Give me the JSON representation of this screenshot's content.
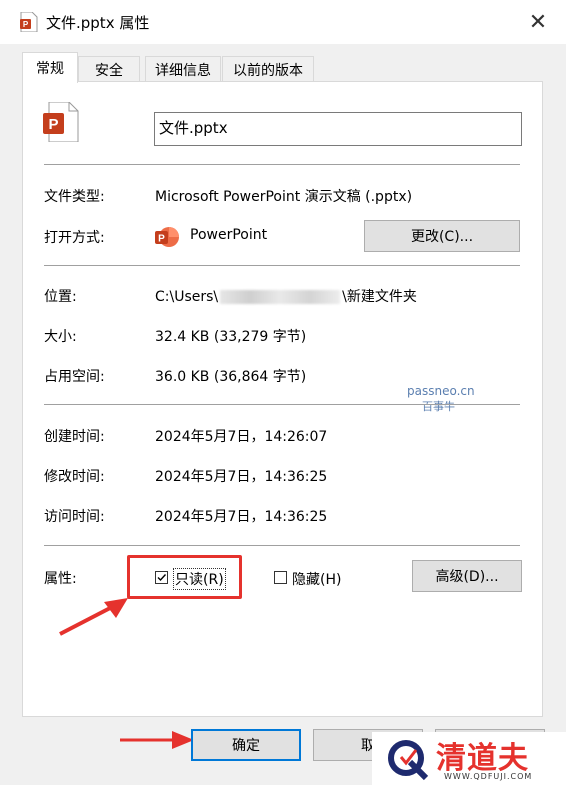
{
  "window": {
    "title": "文件.pptx 属性",
    "close_glyph": "✕"
  },
  "tabs": [
    {
      "label": "常规",
      "active": true
    },
    {
      "label": "安全",
      "active": false
    },
    {
      "label": "详细信息",
      "active": false
    },
    {
      "label": "以前的版本",
      "active": false
    }
  ],
  "file": {
    "name": "文件.pptx"
  },
  "details": {
    "type_label": "文件类型:",
    "type_value": "Microsoft PowerPoint 演示文稿 (.pptx)",
    "opens_label": "打开方式:",
    "opens_value": "PowerPoint",
    "change_button": "更改(C)...",
    "location_label": "位置:",
    "location_prefix": "C:\\Users\\",
    "location_suffix": "\\新建文件夹",
    "size_label": "大小:",
    "size_value": "32.4 KB (33,279 字节)",
    "disk_label": "占用空间:",
    "disk_value": "36.0 KB (36,864 字节)",
    "created_label": "创建时间:",
    "created_value": "2024年5月7日，14:26:07",
    "modified_label": "修改时间:",
    "modified_value": "2024年5月7日，14:36:25",
    "accessed_label": "访问时间:",
    "accessed_value": "2024年5月7日，14:36:25"
  },
  "attributes": {
    "label": "属性:",
    "readonly_label": "只读(R)",
    "readonly_checked": true,
    "hidden_label": "隐藏(H)",
    "hidden_checked": false,
    "advanced_button": "高级(D)..."
  },
  "footer": {
    "ok_button": "确定",
    "cancel_button": "取"
  },
  "watermark": {
    "line1": "passneo.cn",
    "line2": "百事牛"
  },
  "logo": {
    "title": "清道夫",
    "url": "WWW.QDFUJI.COM"
  },
  "colors": {
    "accent": "#e5322d",
    "ppt_orange": "#c43e1c",
    "focus_blue": "#0078d7"
  }
}
